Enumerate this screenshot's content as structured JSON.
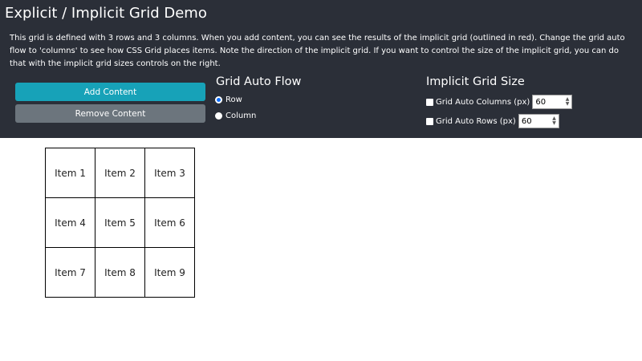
{
  "header": {
    "title": "Explicit / Implicit Grid Demo",
    "description": "This grid is defined with 3 rows and 3 columns. When you add content, you can see the results of the implicit grid (outlined in red). Change the grid auto flow to 'columns' to see how CSS Grid places items. Note the direction of the implicit grid. If you want to control the size of the implicit grid, you can do that with the implicit grid sizes controls on the right.",
    "bg_color": "#2b2f38"
  },
  "buttons": {
    "add_label": "Add Content",
    "add_color": "#17a2b8",
    "remove_label": "Remove Content",
    "remove_color": "#6c757d"
  },
  "auto_flow": {
    "heading": "Grid Auto Flow",
    "options": [
      {
        "label": "Row",
        "checked": true
      },
      {
        "label": "Column",
        "checked": false
      }
    ]
  },
  "implicit_size": {
    "heading": "Implicit Grid Size",
    "columns_label": "Grid Auto Columns (px)",
    "columns_checked": false,
    "columns_value": "60",
    "rows_label": "Grid Auto Rows (px)",
    "rows_checked": false,
    "rows_value": "60"
  },
  "grid_items": [
    "Item 1",
    "Item 2",
    "Item 3",
    "Item 4",
    "Item 5",
    "Item 6",
    "Item 7",
    "Item 8",
    "Item 9"
  ]
}
